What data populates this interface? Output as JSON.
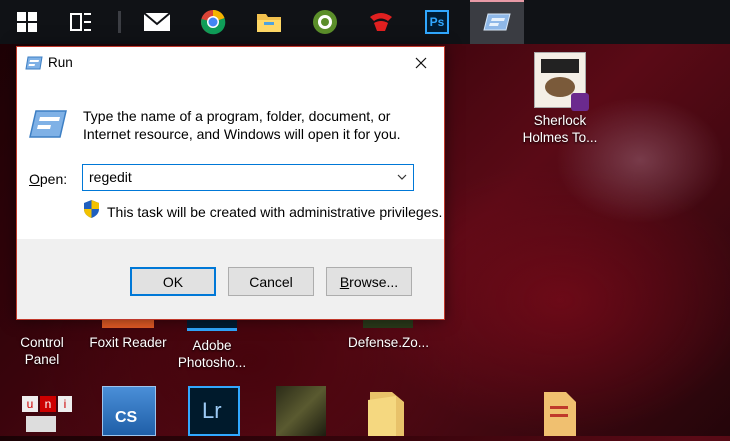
{
  "taskbar": {
    "items": [
      {
        "name": "start-button",
        "icon": "windows-logo-icon"
      },
      {
        "name": "task-view-button",
        "icon": "task-view-icon"
      },
      {
        "name": "mail-app",
        "icon": "mail-icon"
      },
      {
        "name": "chrome-app",
        "icon": "chrome-icon"
      },
      {
        "name": "file-explorer-app",
        "icon": "folder-icon"
      },
      {
        "name": "coccoc-app",
        "icon": "coccoc-icon"
      },
      {
        "name": "garena-app",
        "icon": "garena-icon"
      },
      {
        "name": "photoshop-app",
        "icon": "photoshop-icon",
        "text": "Ps"
      },
      {
        "name": "run-app",
        "icon": "run-icon",
        "active": true
      }
    ],
    "accent": "#e89aa6"
  },
  "desktop": {
    "icons": {
      "sherlock": "Sherlock Holmes To...",
      "control_panel": "Control Panel",
      "foxit": "Foxit Reader",
      "adobe_ps": "Adobe Photosho...",
      "defense": "Defense.Zo...",
      "lr_text": "Lr",
      "cs_text": "CS",
      "unikey_u": "u",
      "unikey_n": "n",
      "unikey_i": "i"
    }
  },
  "run_dialog": {
    "title": "Run",
    "description": "Type the name of a program, folder, document, or Internet resource, and Windows will open it for you.",
    "open_label_underlined": "O",
    "open_label_rest": "pen:",
    "input_value": "regedit",
    "admin_note": "This task will be created with administrative privileges.",
    "ok_label": "OK",
    "cancel_label": "Cancel",
    "browse_label_underlined": "B",
    "browse_label_rest": "rowse...",
    "accent": "#0078d7"
  }
}
